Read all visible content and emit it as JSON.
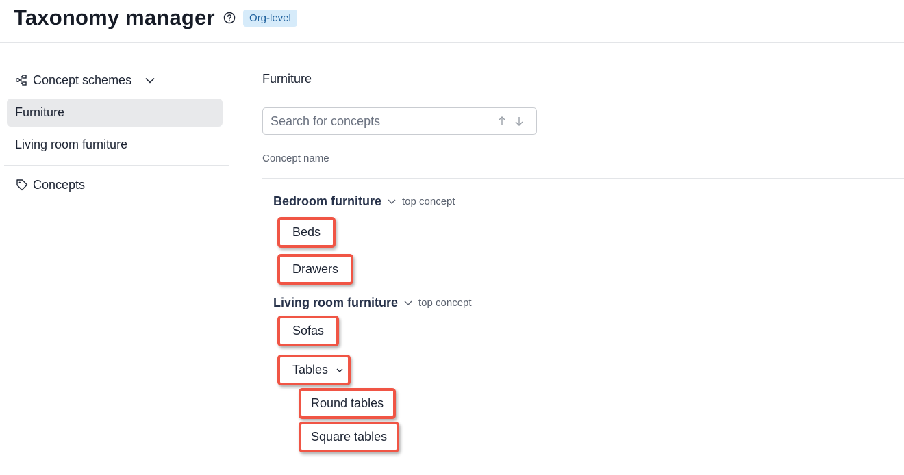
{
  "header": {
    "title": "Taxonomy manager",
    "help_icon": "question-circle-icon",
    "badge": "Org-level"
  },
  "sidebar": {
    "schemes_label": "Concept schemes",
    "schemes_icon": "hierarchy-icon",
    "items": [
      {
        "label": "Furniture",
        "active": true
      },
      {
        "label": "Living room furniture",
        "active": false
      }
    ],
    "concepts_label": "Concepts",
    "concepts_icon": "tag-icon"
  },
  "main": {
    "title": "Furniture",
    "search": {
      "placeholder": "Search for concepts",
      "value": ""
    },
    "column_header": "Concept name",
    "top_concepts": [
      {
        "name": "Bedroom furniture",
        "tag": "top concept",
        "children": [
          {
            "label": "Beds"
          },
          {
            "label": "Drawers"
          }
        ]
      },
      {
        "name": "Living room furniture",
        "tag": "top concept",
        "children": [
          {
            "label": "Sofas"
          },
          {
            "label": "Tables",
            "expandable": true,
            "children": [
              {
                "label": "Round tables"
              },
              {
                "label": "Square tables"
              }
            ]
          }
        ]
      }
    ]
  },
  "colors": {
    "highlight_border": "#f05545",
    "badge_bg": "#d6ebfa",
    "badge_text": "#1d5f9c",
    "active_item_bg": "#e8e9eb"
  }
}
